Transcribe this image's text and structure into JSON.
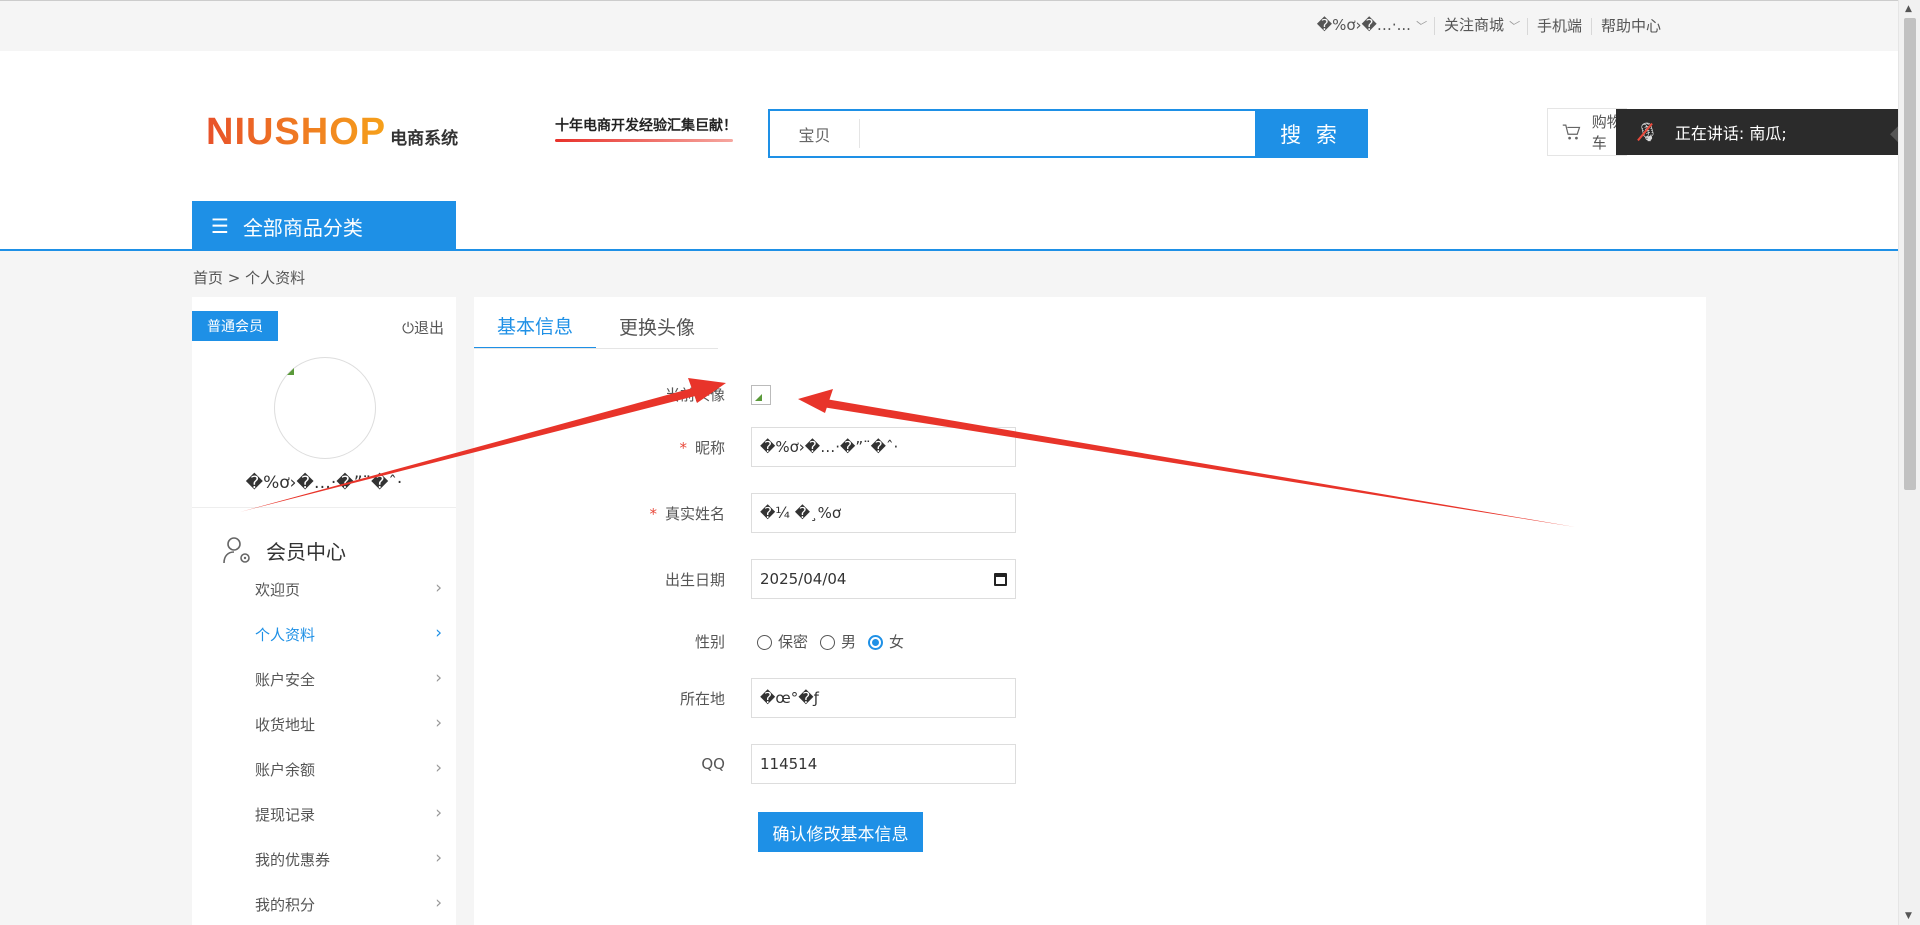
{
  "topbar": {
    "user_label": "�%ơ›�…·...",
    "follow_label": "关注商城",
    "mobile_label": "手机端",
    "help_label": "帮助中心"
  },
  "header": {
    "logo_brand": "NIUSHOP",
    "logo_sub": "电商系统",
    "slogan": "十年电商开发经验汇集巨献！",
    "search_category": "宝贝",
    "search_value": "",
    "search_button": "搜 索",
    "cart_label": "购物车",
    "all_categories": "全部商品分类"
  },
  "voice_overlay": {
    "label": "正在讲话:  南瓜;"
  },
  "breadcrumb": "首页 > 个人资料",
  "sidebar": {
    "member_badge": "普通会员",
    "logout_label": "退出",
    "username": "�%ơ›�…·�”¨�ˆ·",
    "member_center": "会员中心",
    "items": [
      {
        "label": "欢迎页",
        "active": false
      },
      {
        "label": "个人资料",
        "active": true
      },
      {
        "label": "账户安全",
        "active": false
      },
      {
        "label": "收货地址",
        "active": false
      },
      {
        "label": "账户余额",
        "active": false
      },
      {
        "label": "提现记录",
        "active": false
      },
      {
        "label": "我的优惠券",
        "active": false
      },
      {
        "label": "我的积分",
        "active": false
      }
    ]
  },
  "tabs": [
    "基本信息",
    "更换头像"
  ],
  "form": {
    "avatar_label": "当前头像",
    "nickname_label": "昵称",
    "nickname_value": "�%ơ›�…·�”¨�ˆ·",
    "realname_label": "真实姓名",
    "realname_value": "�¼ �¸%ơ",
    "birthday_label": "出生日期",
    "birthday_value": "2025/04/04",
    "gender_label": "性别",
    "gender_options": [
      "保密",
      "男",
      "女"
    ],
    "gender_selected": "女",
    "location_label": "所在地",
    "location_value": "�œ°�ƒ",
    "qq_label": "QQ",
    "qq_value": "114514",
    "submit_label": "确认修改基本信息"
  },
  "colors": {
    "accent": "#1e90e6",
    "required": "#e84a3c",
    "annotation_arrow": "#e8342a"
  }
}
